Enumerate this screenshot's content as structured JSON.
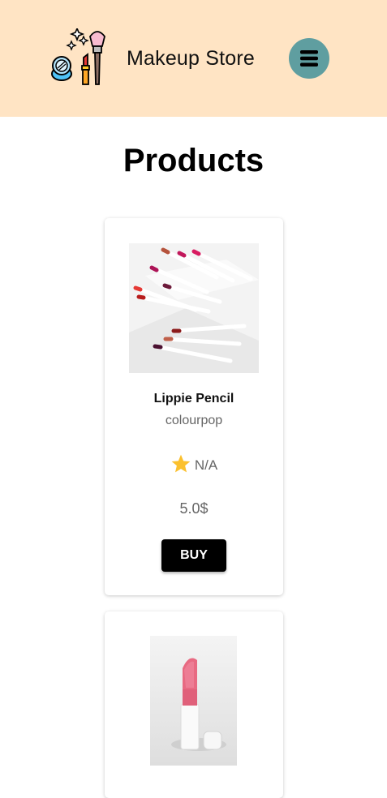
{
  "header": {
    "brand": "Makeup Store",
    "logo_icon": "makeup-kit-icon",
    "menu_icon": "hamburger-menu-icon",
    "background_color": "#ffe4c4",
    "menu_button_color": "#5f9ea0"
  },
  "page": {
    "title": "Products"
  },
  "products": [
    {
      "name": "Lippie Pencil",
      "brand": "colourpop",
      "rating": "N/A",
      "price": "5.0$",
      "buy_label": "BUY",
      "image_icon": "lip-pencils-image"
    },
    {
      "image_icon": "lipstick-image"
    }
  ],
  "colors": {
    "star": "#fbc02d",
    "buy_button": "#000000"
  }
}
